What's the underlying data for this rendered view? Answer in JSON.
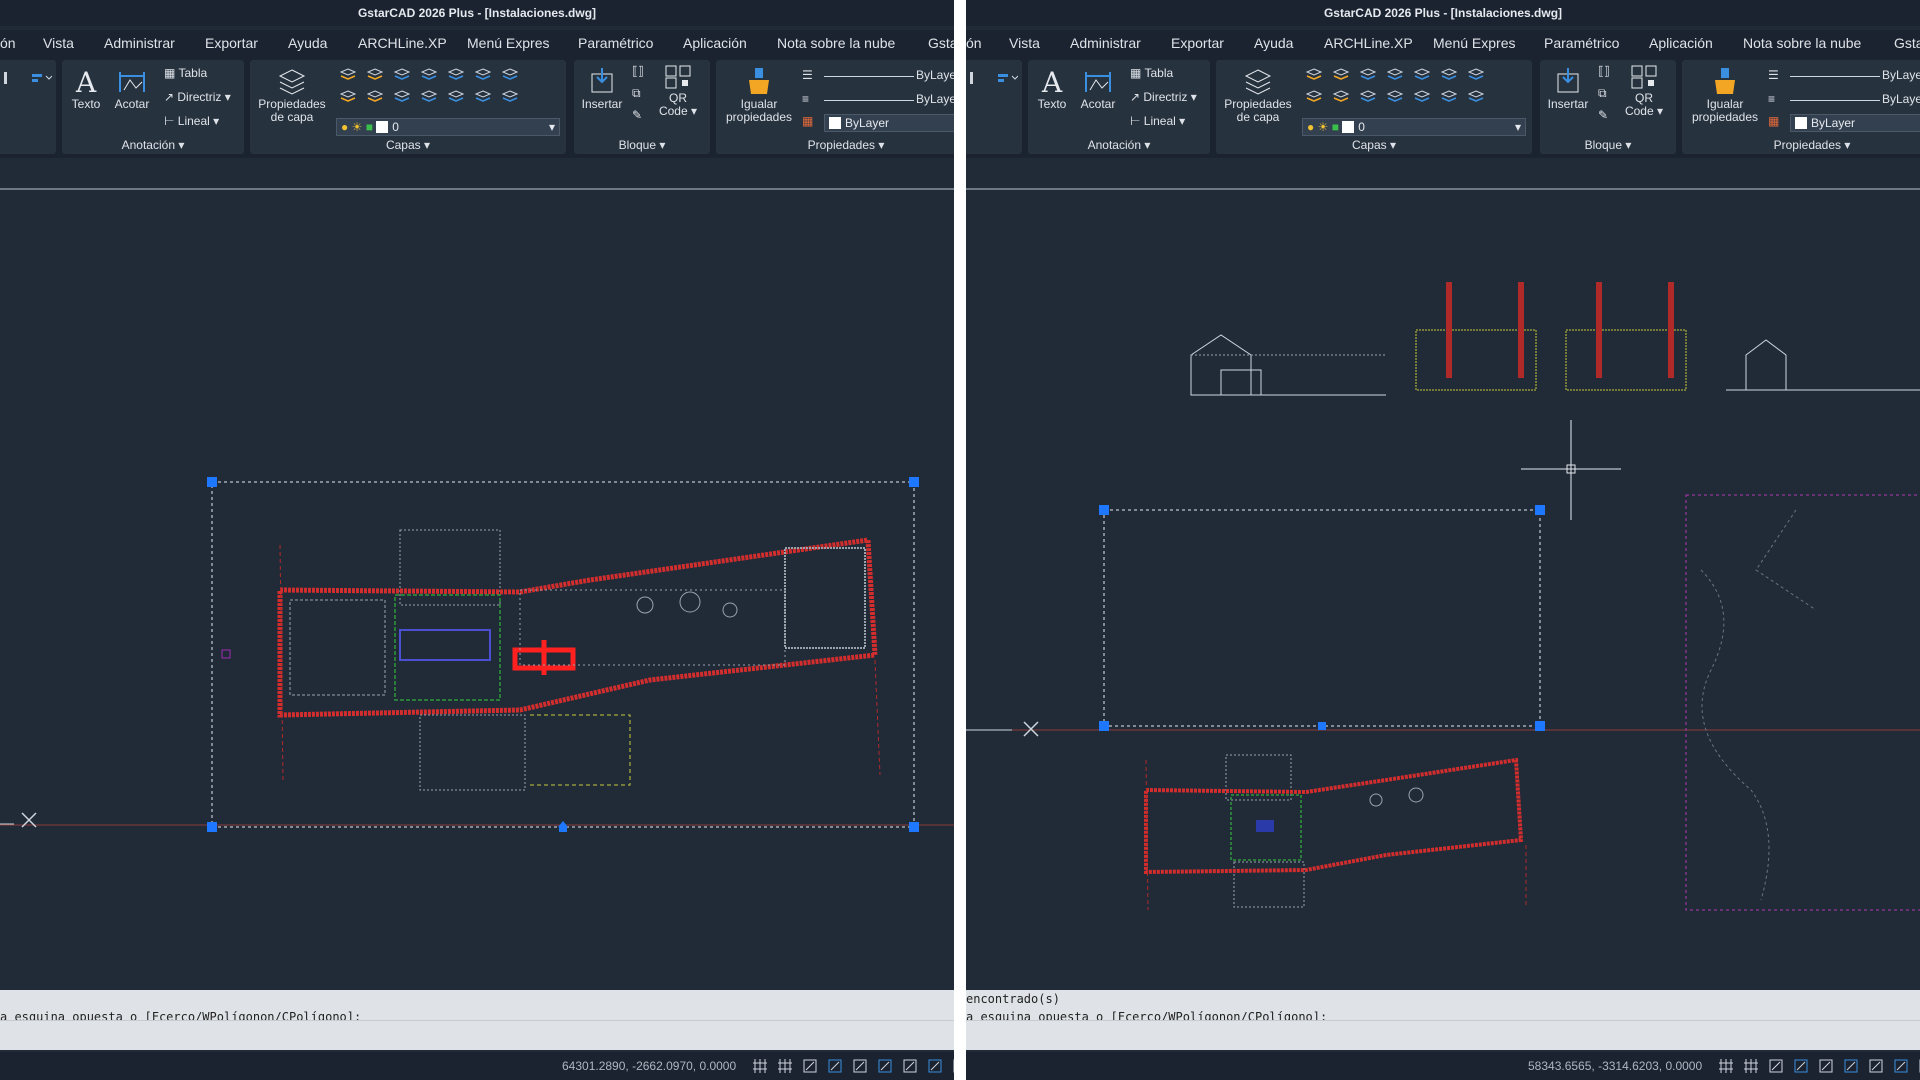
{
  "colors": {
    "background": "#212b38",
    "ribbon": "#1b2330",
    "panel": "#27323f",
    "selection_grip": "#1e78ff",
    "building_outline": "#d42d2d"
  },
  "left": {
    "title": "GstarCAD 2026 Plus - [Instalaciones.dwg]",
    "menu": [
      "ón",
      "Vista",
      "Administrar",
      "Exportar",
      "Ayuda",
      "ARCHLine.XP",
      "Menú Expres",
      "Paramétrico",
      "Aplicación",
      "Nota sobre la nube",
      "Gsta"
    ],
    "ribbon": {
      "anotacion": {
        "title": "Anotación ▾",
        "texto": "Texto",
        "acotar": "Acotar",
        "tabla": "Tabla",
        "directriz": "Directriz",
        "lineal": "Lineal"
      },
      "capas": {
        "title": "Capas ▾",
        "propiedades_1": "Propiedades",
        "propiedades_2": "de capa",
        "layer_value": "0"
      },
      "bloque": {
        "title": "Bloque ▾",
        "insertar": "Insertar",
        "qr_1": "QR",
        "qr_2": "Code"
      },
      "propiedades": {
        "title": "Propiedades ▾",
        "igualar_1": "Igualar",
        "igualar_2": "propiedades",
        "bylayer_1": "ByLayer",
        "bylayer_2": "ByLayer",
        "bylayer_3": "ByLayer"
      }
    },
    "command": {
      "line1": "",
      "line2": "a esquina opuesta o [Fcerco/WPolígonon/CPolígono]:"
    },
    "status": {
      "coords": "64301.2890, -2662.0970, 0.0000"
    }
  },
  "right": {
    "title": "GstarCAD 2026 Plus - [Instalaciones.dwg]",
    "menu": [
      "ón",
      "Vista",
      "Administrar",
      "Exportar",
      "Ayuda",
      "ARCHLine.XP",
      "Menú Expres",
      "Paramétrico",
      "Aplicación",
      "Nota sobre la nube",
      "Gsta"
    ],
    "ribbon": {
      "anotacion": {
        "title": "Anotación ▾",
        "texto": "Texto",
        "acotar": "Acotar",
        "tabla": "Tabla",
        "directriz": "Directriz",
        "lineal": "Lineal"
      },
      "capas": {
        "title": "Capas ▾",
        "propiedades_1": "Propiedades",
        "propiedades_2": "de capa",
        "layer_value": "0"
      },
      "bloque": {
        "title": "Bloque ▾",
        "insertar": "Insertar",
        "qr_1": "QR",
        "qr_2": "Code"
      },
      "propiedades": {
        "title": "Propiedades ▾",
        "igualar_1": "Igualar",
        "igualar_2": "propiedades",
        "bylayer_1": "ByLayer",
        "bylayer_2": "ByLayer",
        "bylayer_3": "ByLayer"
      }
    },
    "command": {
      "line1": "encontrado(s)",
      "line2": "a esquina opuesta o [Fcerco/WPolígonon/CPolígono]:"
    },
    "status": {
      "coords": "58343.6565, -3314.6203, 0.0000"
    }
  }
}
